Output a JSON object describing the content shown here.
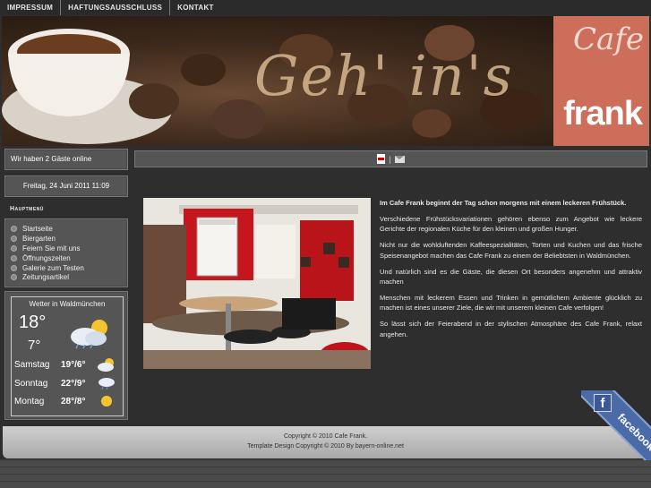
{
  "topnav": {
    "items": [
      "IMPRESSUM",
      "HAFTUNGSAUSSCHLUSS",
      "KONTAKT"
    ]
  },
  "banner": {
    "slogan": "Geh' in's",
    "logo_top": "Cafe",
    "logo_bottom": "frank"
  },
  "sidebar": {
    "guests": "Wir haben 2 Gäste online",
    "date": "Freitag, 24 Juni 2011 11:09",
    "menu_title": "Hauptmenü",
    "menu_items": [
      "Startseite",
      "Biergarten",
      "Feiern Sie mit uns",
      "Öffnungszeiten",
      "Galerie zum Testen",
      "Zeitungsartikel"
    ]
  },
  "weather": {
    "title": "Wetter in Waldmünchen",
    "current_high": "18°",
    "current_low": "7°",
    "forecast": [
      {
        "day": "Samstag",
        "temps": "19°/6°",
        "icon": "partly-cloudy-icon"
      },
      {
        "day": "Sonntag",
        "temps": "22°/9°",
        "icon": "rain-cloud-icon"
      },
      {
        "day": "Montag",
        "temps": "28°/8°",
        "icon": "sun-icon"
      }
    ]
  },
  "toolbar": {
    "separator": "|",
    "icons": [
      "pdf-icon",
      "email-icon"
    ]
  },
  "article": {
    "paragraphs": [
      "Im Cafe Frank beginnt der Tag schon morgens mit einem leckeren Frühstück.",
      "Verschiedene Frühstücksvariationen gehören ebenso zum Angebot wie leckere Gerichte der regionalen Küche für den kleinen und großen Hunger.",
      "Nicht nur die wohlduftenden Kaffeespezialitäten, Torten und Kuchen und das frische Speisenangebot machen das Cafe Frank zu einem der Beliebtsten in Waldmünchen.",
      "Und natürlich sind es die Gäste, die diesen Ort besonders angenehm und attraktiv machen",
      "Menschen mit leckerem Essen und Trinken in gemütlichem Ambiente glücklich zu machen ist eines unserer Ziele, die wir mit unserem kleinen Cafe verfolgen!",
      "So lässt sich der Feierabend in der stylischen Atmosphäre des Cafe Frank, relaxt angehen."
    ]
  },
  "footer": {
    "line1": "Copyright © 2010 Cafe Frank.",
    "line2": "Template Design Copyright © 2010 By bayern-online.net"
  },
  "facebook": {
    "label": "facebook",
    "letter": "f"
  }
}
